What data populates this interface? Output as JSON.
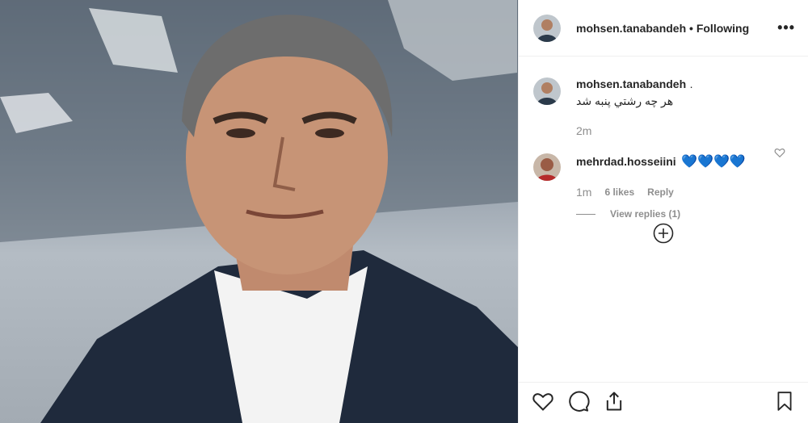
{
  "post": {
    "photo_alt": "portrait photo",
    "author": "mohsen.tanabandeh",
    "separator": "•",
    "follow_state": "Following",
    "more_label": "•••"
  },
  "comments": [
    {
      "username": "mohsen.tanabandeh",
      "suffix": ".",
      "text": "هر چه رشتي پنبه شد",
      "time": "2m"
    },
    {
      "username": "mehrdad.hosseiini",
      "text": "💙💙💙💙",
      "time": "1m",
      "likes": "6 likes",
      "reply_label": "Reply",
      "view_replies": "View replies (1)"
    }
  ],
  "icons": {
    "like": "heart-icon",
    "comment": "comment-icon",
    "share": "share-icon",
    "save": "bookmark-icon",
    "load_more": "plus-circle-icon"
  },
  "colors": {
    "heart_blue": "#1a9be0",
    "muted": "#8e8e8e"
  }
}
